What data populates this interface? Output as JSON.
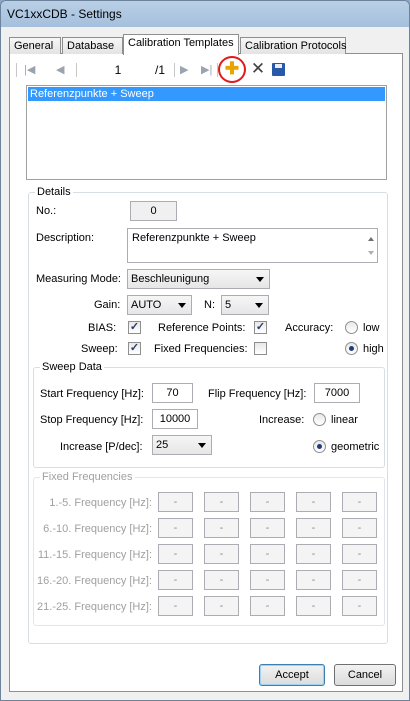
{
  "window": {
    "title": "VC1xxCDB - Settings"
  },
  "tabs": [
    "General",
    "Database",
    "Calibration Templates",
    "Calibration Protocols"
  ],
  "navigator": {
    "first": "|◀",
    "prev": "◀",
    "position": "1",
    "count": "/1",
    "next": "▶",
    "last": "▶|",
    "add_icon": "plus-icon",
    "delete_icon": "delete-x-icon",
    "save_icon": "save-disk-icon"
  },
  "template_list": [
    "Referenzpunkte + Sweep"
  ],
  "details": {
    "legend": "Details",
    "no_label": "No.:",
    "no_value": "0",
    "description_label": "Description:",
    "description_value": "Referenzpunkte + Sweep",
    "measuring_mode_label": "Measuring Mode:",
    "measuring_mode_value": "Beschleunigung",
    "gain_label": "Gain:",
    "gain_value": "AUTO",
    "n_label": "N:",
    "n_value": "5",
    "bias_label": "BIAS:",
    "bias_checked": "✓",
    "reference_points_label": "Reference Points:",
    "reference_points_checked": "✓",
    "accuracy_label": "Accuracy:",
    "accuracy_low": "low",
    "accuracy_high": "high",
    "sweep_label": "Sweep:",
    "sweep_checked": "✓",
    "fixed_frequencies_label": "Fixed Frequencies:"
  },
  "sweep": {
    "legend": "Sweep Data",
    "start_label": "Start Frequency [Hz]:",
    "start_value": "70",
    "flip_label": "Flip Frequency [Hz]:",
    "flip_value": "7000",
    "stop_label": "Stop Frequency [Hz]:",
    "stop_value": "10000",
    "increase_label": "Increase:",
    "increase_linear": "linear",
    "increase_geometric": "geometric",
    "increase_per_dec_label": "Increase [P/dec]:",
    "increase_per_dec_value": "25"
  },
  "fixed": {
    "legend": "Fixed Frequencies",
    "rows": [
      {
        "label": "1.-5. Frequency [Hz]:",
        "values": [
          "-",
          "-",
          "-",
          "-",
          "-"
        ]
      },
      {
        "label": "6.-10. Frequency [Hz]:",
        "values": [
          "-",
          "-",
          "-",
          "-",
          "-"
        ]
      },
      {
        "label": "11.-15. Frequency [Hz]:",
        "values": [
          "-",
          "-",
          "-",
          "-",
          "-"
        ]
      },
      {
        "label": "16.-20. Frequency [Hz]:",
        "values": [
          "-",
          "-",
          "-",
          "-",
          "-"
        ]
      },
      {
        "label": "21.-25. Frequency [Hz]:",
        "values": [
          "-",
          "-",
          "-",
          "-",
          "-"
        ]
      }
    ]
  },
  "buttons": {
    "accept": "Accept",
    "cancel": "Cancel"
  },
  "colors": {
    "selection": "#3399ff",
    "highlight_ring": "#e01919",
    "add_icon": "#e8a400"
  }
}
